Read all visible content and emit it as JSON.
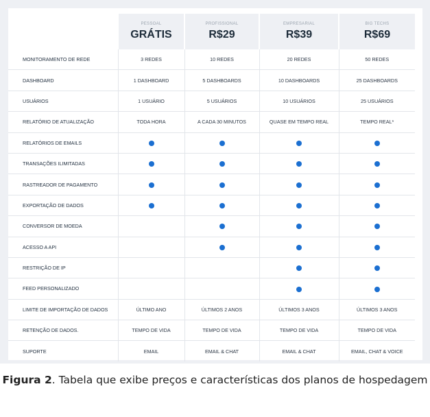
{
  "plans": [
    {
      "name": "PESSOAL",
      "price": "GRÁTIS"
    },
    {
      "name": "PROFISSIONAL",
      "price": "R$29"
    },
    {
      "name": "EMPRESARIAL",
      "price": "R$39"
    },
    {
      "name": "BIG TECHS",
      "price": "R$69"
    }
  ],
  "rows": [
    {
      "feature": "MONITORAMENTO DE REDE",
      "values": [
        "3 REDES",
        "10 REDES",
        "20 REDES",
        "50 REDES"
      ]
    },
    {
      "feature": "DASHBOARD",
      "values": [
        "1 DASHBOARD",
        "5 DASHBOARDs",
        "10 DASHBOARDS",
        "25 DASHBOARDS"
      ]
    },
    {
      "feature": "USUÁRIOS",
      "values": [
        "1 USUÁRIO",
        "5 USUÁRIOS",
        "10 USUÁRIOS",
        "25 USUÁRIOS"
      ]
    },
    {
      "feature": "RELATÓRIO DE ATUALIZAÇÃO",
      "values": [
        "TODA HORA",
        "A CADA 30 MINUTOS",
        "QUASE EM TEMPO REAL",
        "TEMPO REAL*"
      ]
    },
    {
      "feature": "RELATÓRIOS DE EMAILS",
      "values": [
        true,
        true,
        true,
        true
      ]
    },
    {
      "feature": "TRANSAÇÕES ILIMITADAS",
      "values": [
        true,
        true,
        true,
        true
      ]
    },
    {
      "feature": "RASTREADOR DE PAGAMENTO",
      "values": [
        true,
        true,
        true,
        true
      ]
    },
    {
      "feature": "EXPORTAÇÃO DE DADOS",
      "values": [
        true,
        true,
        true,
        true
      ]
    },
    {
      "feature": "CONVERSOR DE MOEDA",
      "values": [
        false,
        true,
        true,
        true
      ]
    },
    {
      "feature": "ACESSO A API",
      "values": [
        false,
        true,
        true,
        true
      ]
    },
    {
      "feature": "RESTRIÇÃO DE IP",
      "values": [
        false,
        false,
        true,
        true
      ]
    },
    {
      "feature": "FEED PERSONALIZADO",
      "values": [
        false,
        false,
        true,
        true
      ]
    },
    {
      "feature": "LIMITE DE IMPORTAÇÃO DE DADOS",
      "values": [
        "ÚLTIMO ANO",
        "ÚLTIMOS 2 ANOS",
        "ÚLTIMOS 3 ANOS",
        "ÚLTIMOS 3 ANOS"
      ]
    },
    {
      "feature": "RETENÇÃO DE DADOS.",
      "values": [
        "TEMPO DE VIDA",
        "TEMPO DE VIDA",
        "TEMPO DE VIDA",
        "TEMPO DE VIDA"
      ]
    },
    {
      "feature": "SUPORTE",
      "values": [
        "EMAIL",
        "EMAIL & CHAT",
        "EMAIL & CHAT",
        "EMAIL, CHAT & VOICE"
      ]
    }
  ],
  "caption": {
    "label": "Figura 2",
    "text": ". Tabela que exibe preços e características dos planos de hospedagem"
  },
  "colors": {
    "dot": "#1b6fd1",
    "header_bg": "#eef0f4"
  },
  "icons": {
    "included": "filled-dot-icon"
  }
}
